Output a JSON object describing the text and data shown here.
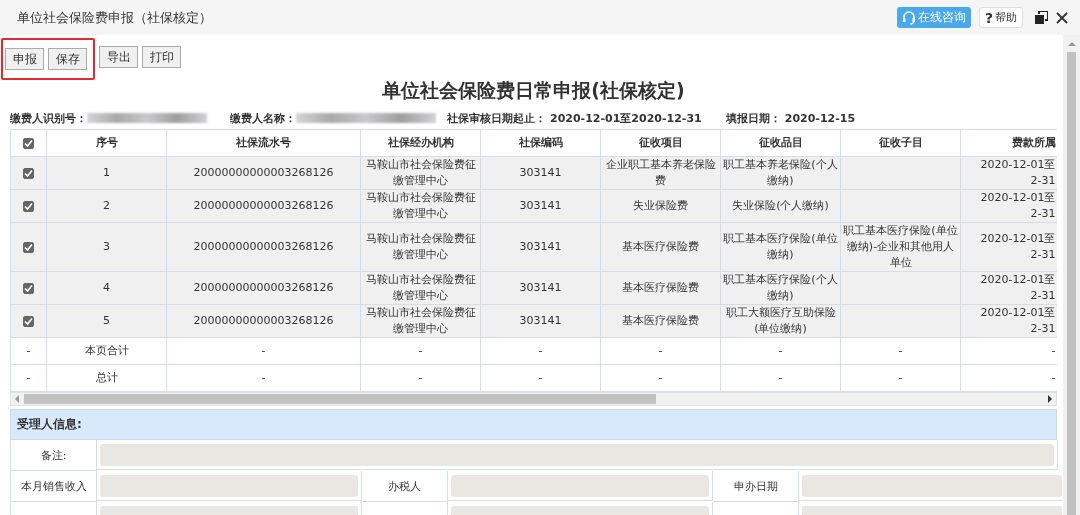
{
  "window": {
    "title": "单位社会保险费申报（社保核定）",
    "consult_button": "在线咨询",
    "help_button": {
      "icon": "?",
      "label": "帮助"
    }
  },
  "toolbar": {
    "highlighted_buttons": [
      "申报",
      "保存"
    ],
    "buttons": [
      "导出",
      "打印"
    ]
  },
  "heading": "单位社会保险费日常申报(社保核定)",
  "info": [
    {
      "label": "缴费人识别号：",
      "redacted": true
    },
    {
      "label": "缴费人名称：",
      "redacted": true
    },
    {
      "label": "社保审核日期起止：",
      "value": "2020-12-01至2020-12-31"
    },
    {
      "label": "填报日期：",
      "value": "2020-12-15"
    }
  ],
  "table": {
    "select_all_checked": true,
    "columns": [
      "序号",
      "社保流水号",
      "社保经办机构",
      "社保编码",
      "征收项目",
      "征收品目",
      "征收子目",
      "费款所属"
    ],
    "rows": [
      {
        "checked": true,
        "cells": [
          "1",
          "20000000000003268126",
          "马鞍山市社会保险费征缴管理中心",
          "303141",
          "企业职工基本养老保险费",
          "职工基本养老保险(个人缴纳)",
          "",
          "2020-12-01至 2-31"
        ]
      },
      {
        "checked": true,
        "cells": [
          "2",
          "20000000000003268126",
          "马鞍山市社会保险费征缴管理中心",
          "303141",
          "失业保险费",
          "失业保险(个人缴纳)",
          "",
          "2020-12-01至 2-31"
        ]
      },
      {
        "checked": true,
        "cells": [
          "3",
          "20000000000003268126",
          "马鞍山市社会保险费征缴管理中心",
          "303141",
          "基本医疗保险费",
          "职工基本医疗保险(单位缴纳)",
          "职工基本医疗保险(单位缴纳)-企业和其他用人单位",
          "2020-12-01至 2-31"
        ]
      },
      {
        "checked": true,
        "cells": [
          "4",
          "20000000000003268126",
          "马鞍山市社会保险费征缴管理中心",
          "303141",
          "基本医疗保险费",
          "职工基本医疗保险(个人缴纳)",
          "",
          "2020-12-01至 2-31"
        ]
      },
      {
        "checked": true,
        "cells": [
          "5",
          "20000000000003268126",
          "马鞍山市社会保险费征缴管理中心",
          "303141",
          "基本医疗保险费",
          "职工大额医疗互助保险(单位缴纳)",
          "",
          "2020-12-01至 2-31"
        ]
      }
    ],
    "total_rows": [
      {
        "mark": "-",
        "cells": [
          "本页合计",
          "-",
          "-",
          "-",
          "-",
          "-",
          "-",
          "-"
        ]
      },
      {
        "mark": "-",
        "cells": [
          "总计",
          "-",
          "-",
          "-",
          "-",
          "-",
          "-",
          "-"
        ]
      }
    ]
  },
  "acceptor": {
    "title": "受理人信息:",
    "remark_label": "备注:",
    "fields": [
      {
        "label": "本月销售收入"
      },
      {
        "label": "办税人"
      },
      {
        "label": "申办日期"
      }
    ]
  }
}
